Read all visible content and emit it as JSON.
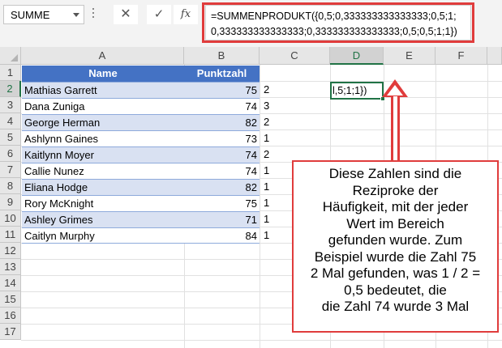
{
  "name_box": {
    "value": "SUMME"
  },
  "formula_bar": {
    "cancel_symbol": "✕",
    "enter_symbol": "✓",
    "fx_label": "fx",
    "formula_line1": "=SUMMENPRODUKT({0,5;0,333333333333333;0,5;1;",
    "formula_line2": "0,333333333333333;0,333333333333333;0,5;0,5;1;1})"
  },
  "columns": [
    "A",
    "B",
    "C",
    "D",
    "E",
    "F"
  ],
  "rows": [
    "1",
    "2",
    "3",
    "4",
    "5",
    "6",
    "7",
    "8",
    "9",
    "10",
    "11",
    "12",
    "13",
    "14",
    "15",
    "16",
    "17"
  ],
  "table": {
    "headers": [
      "Name",
      "Punktzahl"
    ],
    "rows": [
      {
        "name": "Mathias Garrett",
        "score": "75",
        "count": "2"
      },
      {
        "name": "Dana Zuniga",
        "score": "74",
        "count": "3"
      },
      {
        "name": "George Herman",
        "score": "82",
        "count": "2"
      },
      {
        "name": "Ashlynn Gaines",
        "score": "73",
        "count": "1"
      },
      {
        "name": "Kaitlynn Moyer",
        "score": "74",
        "count": "2"
      },
      {
        "name": "Callie Nunez",
        "score": "74",
        "count": "1"
      },
      {
        "name": "Eliana Hodge",
        "score": "82",
        "count": "1"
      },
      {
        "name": "Rory McKnight",
        "score": "75",
        "count": "1"
      },
      {
        "name": "Ashley Grimes",
        "score": "71",
        "count": "1"
      },
      {
        "name": "Caitlyn Murphy",
        "score": "84",
        "count": "1"
      }
    ]
  },
  "active_cell": {
    "address": "D2",
    "display": "l,5;1;1})"
  },
  "callout": {
    "lines": [
      "Diese Zahlen sind die",
      "Reziproke der",
      "Häufigkeit, mit der jeder",
      "Wert im Bereich",
      "gefunden wurde. Zum",
      "Beispiel wurde die Zahl 75",
      "2 Mal gefunden, was 1 / 2 =",
      "0,5 bedeutet, die",
      "die Zahl 74 wurde 3 Mal"
    ]
  },
  "colors": {
    "table_header": "#4472c4",
    "band": "#d9e1f2",
    "excel_green": "#217346",
    "callout_red": "#e03c3c"
  }
}
